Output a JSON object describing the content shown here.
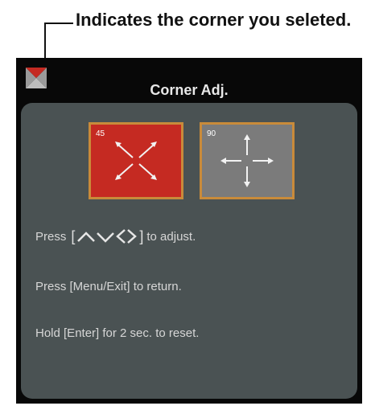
{
  "callout": {
    "text": "Indicates the corner you seleted."
  },
  "osd": {
    "title": "Corner Adj.",
    "corner_icon": "corner-selector-icon",
    "boxes": [
      {
        "label": "45",
        "icon": "diagonal-arrows-icon",
        "color": "#c52a22",
        "selected": true
      },
      {
        "label": "90",
        "icon": "cross-arrows-icon",
        "color": "#7b7b7b",
        "selected": false
      }
    ],
    "instructions": {
      "adjust_prefix": "Press",
      "bracket_open": "[",
      "bracket_close": "]",
      "adjust_suffix": "to adjust.",
      "return_text": "Press [Menu/Exit] to return.",
      "reset_text": "Hold [Enter] for 2 sec. to reset."
    }
  },
  "colors": {
    "background": "#080808",
    "panel": "#4a5253",
    "accent": "#c98b3a",
    "selected": "#c52a22"
  }
}
